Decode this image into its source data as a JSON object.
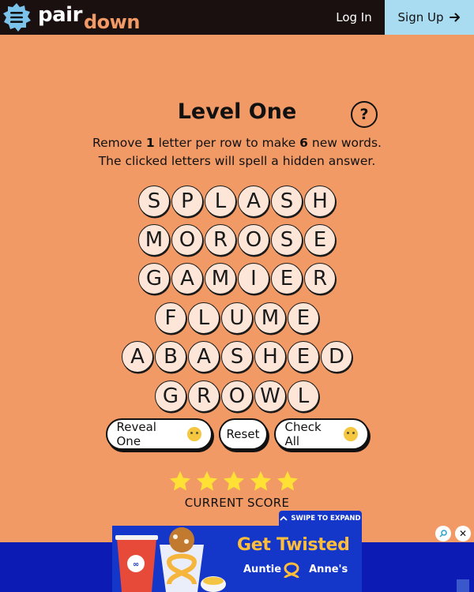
{
  "header": {
    "logo_top": "pair",
    "logo_bottom": "down",
    "login_label": "Log In",
    "signup_label": "Sign Up"
  },
  "game": {
    "title": "Level One",
    "help_label": "?",
    "instr1": {
      "a": "Remove ",
      "b": "1",
      "c": " letter per row to make ",
      "d": "6",
      "e": " new words."
    },
    "instr2": "The clicked letters will spell a hidden answer.",
    "rows": [
      [
        "S",
        "P",
        "L",
        "A",
        "S",
        "H"
      ],
      [
        "M",
        "O",
        "R",
        "O",
        "S",
        "E"
      ],
      [
        "G",
        "A",
        "M",
        "I",
        "E",
        "R"
      ],
      [
        "F",
        "L",
        "U",
        "M",
        "E"
      ],
      [
        "A",
        "B",
        "A",
        "S",
        "H",
        "E",
        "D"
      ],
      [
        "G",
        "R",
        "O",
        "W",
        "L"
      ]
    ],
    "buttons": {
      "reveal": "Reveal One",
      "reset": "Reset",
      "check": "Check All"
    },
    "stars": 5,
    "score_label": "CURRENT SCORE"
  },
  "ad": {
    "swipe_label": "SWIPE TO EXPAND",
    "headline": "Get Twisted",
    "brand_left": "Auntie",
    "brand_right": "Anne's",
    "close_label": "✕"
  },
  "colors": {
    "background": "#f29a66",
    "header": "#1b1010",
    "signup": "#a9dcf0",
    "tile": "#fde6d8",
    "star": "#ffe135",
    "ad": "#0b1bb4"
  }
}
